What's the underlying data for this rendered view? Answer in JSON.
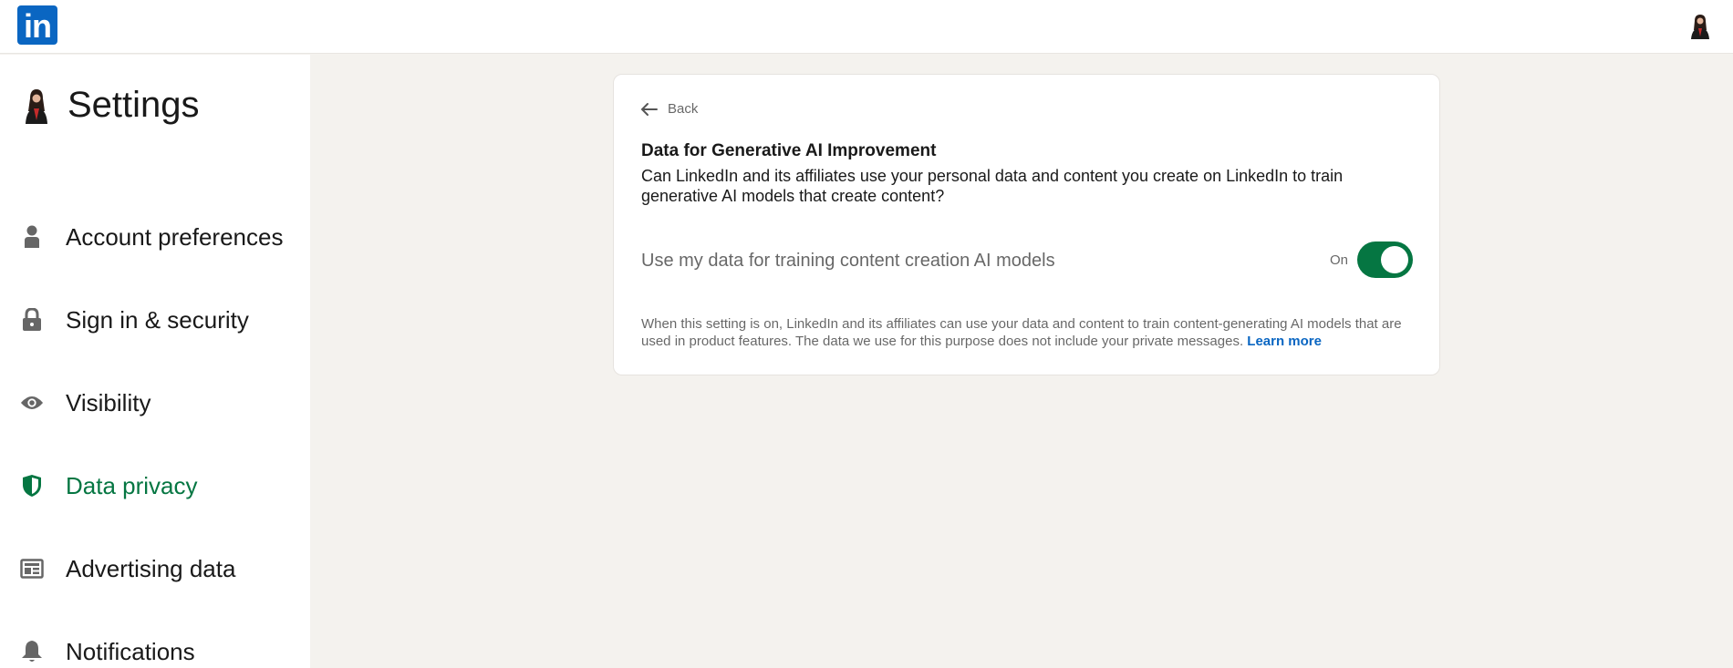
{
  "header": {
    "logo_text": "in",
    "brand_color": "#0a66c2"
  },
  "sidebar": {
    "title": "Settings",
    "items": [
      {
        "label": "Account preferences",
        "icon": "person-icon",
        "active": false
      },
      {
        "label": "Sign in & security",
        "icon": "lock-icon",
        "active": false
      },
      {
        "label": "Visibility",
        "icon": "eye-icon",
        "active": false
      },
      {
        "label": "Data privacy",
        "icon": "shield-icon",
        "active": true
      },
      {
        "label": "Advertising data",
        "icon": "newspaper-icon",
        "active": false
      },
      {
        "label": "Notifications",
        "icon": "bell-icon",
        "active": false
      }
    ],
    "active_color": "#057642"
  },
  "main": {
    "back_label": "Back",
    "title": "Data for Generative AI Improvement",
    "question": "Can LinkedIn and its affiliates use your personal data and content you create on LinkedIn to train generative AI models that create content?",
    "setting_label": "Use my data for training content creation AI models",
    "toggle_state": "On",
    "toggle_color": "#057642",
    "note": "When this setting is on, LinkedIn and its affiliates can use your data and content to train content-generating AI models that are used in product features. The data we use for this purpose does not include your private messages.",
    "learn_more": "Learn more"
  }
}
